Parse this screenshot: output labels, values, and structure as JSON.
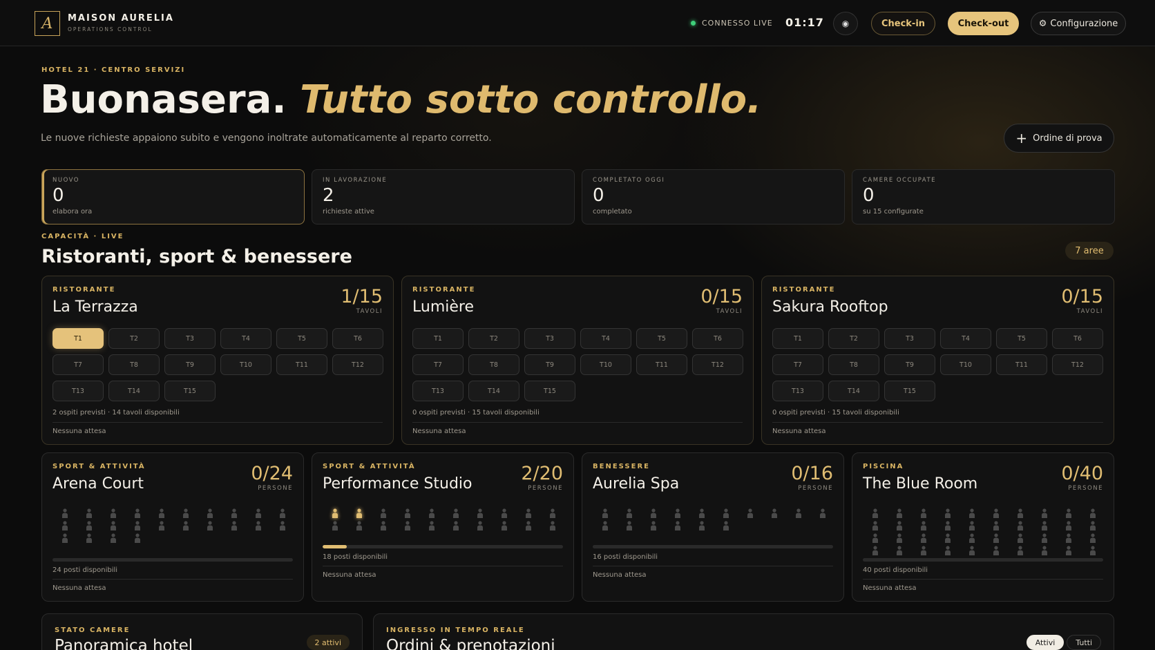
{
  "header": {
    "logo_letter": "A",
    "brand_name": "MAISON AURELIA",
    "brand_sub": "OPERATIONS CONTROL",
    "live_label": "CONNESSO LIVE",
    "clock": "01:17",
    "theme_icon": "◉",
    "checkin_label": "Check-in",
    "checkout_label": "Check-out",
    "config_icon": "⚙",
    "config_label": "Configurazione"
  },
  "hero": {
    "eyebrow": "HOTEL 21 · CENTRO SERVIZI",
    "title_main": "Buonasera.",
    "title_accent": "Tutto sotto controllo.",
    "subtitle": "Le nuove richieste appaiono subito e vengono inoltrate automaticamente al reparto corretto.",
    "test_order_label": "Ordine di prova",
    "test_order_icon": "+"
  },
  "stats": [
    {
      "label": "NUOVO",
      "value": "0",
      "sub": "elabora ora"
    },
    {
      "label": "IN LAVORAZIONE",
      "value": "2",
      "sub": "richieste attive"
    },
    {
      "label": "COMPLETATO OGGI",
      "value": "0",
      "sub": "completato"
    },
    {
      "label": "CAMERE OCCUPATE",
      "value": "0",
      "sub": "su 15 configurate"
    }
  ],
  "capacity": {
    "eyebrow": "CAPACITÀ · LIVE",
    "title": "Ristoranti, sport & benessere",
    "badge": "7 aree"
  },
  "restaurants": [
    {
      "category": "RISTORANTE",
      "name": "La Terrazza",
      "count": "1/15",
      "unit": "TAVOLI",
      "tables": [
        "T1",
        "T2",
        "T3",
        "T4",
        "T5",
        "T6",
        "T7",
        "T8",
        "T9",
        "T10",
        "T11",
        "T12",
        "T13",
        "T14",
        "T15"
      ],
      "occupied": [
        "T1"
      ],
      "info": "2 ospiti previsti · 14 tavoli disponibili",
      "wait": "Nessuna attesa"
    },
    {
      "category": "RISTORANTE",
      "name": "Lumière",
      "count": "0/15",
      "unit": "TAVOLI",
      "tables": [
        "T1",
        "T2",
        "T3",
        "T4",
        "T5",
        "T6",
        "T7",
        "T8",
        "T9",
        "T10",
        "T11",
        "T12",
        "T13",
        "T14",
        "T15"
      ],
      "occupied": [],
      "info": "0 ospiti previsti · 15 tavoli disponibili",
      "wait": "Nessuna attesa"
    },
    {
      "category": "RISTORANTE",
      "name": "Sakura Rooftop",
      "count": "0/15",
      "unit": "TAVOLI",
      "tables": [
        "T1",
        "T2",
        "T3",
        "T4",
        "T5",
        "T6",
        "T7",
        "T8",
        "T9",
        "T10",
        "T11",
        "T12",
        "T13",
        "T14",
        "T15"
      ],
      "occupied": [],
      "info": "0 ospiti previsti · 15 tavoli disponibili",
      "wait": "Nessuna attesa"
    }
  ],
  "facilities": [
    {
      "category": "SPORT & ATTIVITÀ",
      "name": "Arena Court",
      "count": "0/24",
      "unit": "PERSONE",
      "capacity": 24,
      "occupied": 0,
      "fill": 0,
      "info": "24 posti disponibili",
      "wait": "Nessuna attesa"
    },
    {
      "category": "SPORT & ATTIVITÀ",
      "name": "Performance Studio",
      "count": "2/20",
      "unit": "PERSONE",
      "capacity": 20,
      "occupied": 2,
      "fill": 0.1,
      "info": "18 posti disponibili",
      "wait": "Nessuna attesa"
    },
    {
      "category": "BENESSERE",
      "name": "Aurelia Spa",
      "count": "0/16",
      "unit": "PERSONE",
      "capacity": 16,
      "occupied": 0,
      "fill": 0,
      "info": "16 posti disponibili",
      "wait": "Nessuna attesa"
    },
    {
      "category": "PISCINA",
      "name": "The Blue Room",
      "count": "0/40",
      "unit": "PERSONE",
      "capacity": 40,
      "occupied": 0,
      "fill": 0,
      "info": "40 posti disponibili",
      "wait": "Nessuna attesa"
    }
  ],
  "rooms_panel": {
    "eyebrow": "STATO CAMERE",
    "title": "Panoramica hotel",
    "badge": "2 attivi"
  },
  "orders_panel": {
    "eyebrow": "INGRESSO IN TEMPO REALE",
    "title": "Ordini & prenotazioni",
    "filter_active": "Attivi",
    "filter_all": "Tutti"
  },
  "colors": {
    "accent": "#e0bd72",
    "live": "#3fcf7a",
    "background": "#0c0c0c"
  }
}
